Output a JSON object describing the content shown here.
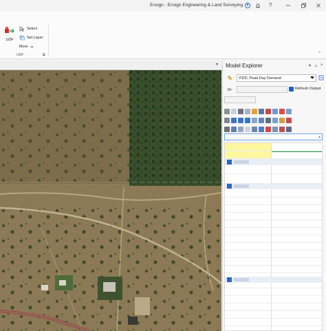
{
  "window": {
    "title": "Ensign - Ensign Engineering & Land Surveying"
  },
  "ribbon": {
    "udf_label": "UDF",
    "select_label": "Select",
    "set_layer_label": "Set Layer",
    "more_label": "More",
    "group_label": "UDF"
  },
  "model_explorer": {
    "title": "Model Explorer",
    "scenario": "PDD, Peak Day Demand",
    "refresh_output_label": "Refresh Output",
    "refresh_output_checked": true
  },
  "colors": {
    "accent": "#1e62c8",
    "selected_cell": "#1b8a3a",
    "highlight_cell": "#fff7a0"
  }
}
